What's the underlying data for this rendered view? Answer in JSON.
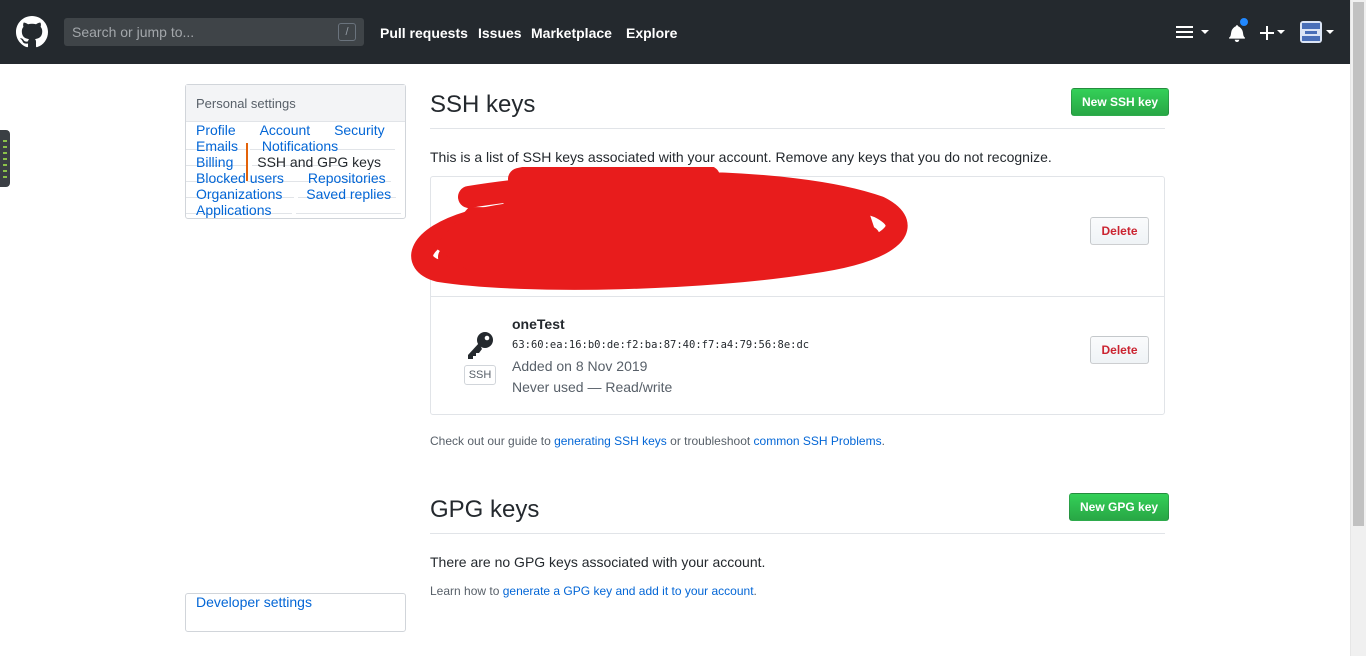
{
  "header": {
    "search_placeholder": "Search or jump to...",
    "search_shortcut": "/",
    "nav": [
      "Pull requests",
      "Issues",
      "Marketplace",
      "Explore"
    ],
    "icons": [
      "github-logo-icon",
      "hamburger-menu-icon",
      "bell-icon",
      "plus-icon",
      "avatar-icon"
    ]
  },
  "sidebar": {
    "heading": "Personal settings",
    "items": [
      {
        "label": "Profile"
      },
      {
        "label": "Account"
      },
      {
        "label": "Security"
      },
      {
        "label": "Emails"
      },
      {
        "label": "Notifications"
      },
      {
        "label": "Billing"
      },
      {
        "label": "SSH and GPG keys",
        "selected": true
      },
      {
        "label": "Blocked users"
      },
      {
        "label": "Repositories"
      },
      {
        "label": "Organizations"
      },
      {
        "label": "Saved replies"
      },
      {
        "label": "Applications"
      }
    ],
    "developer": "Developer settings"
  },
  "ssh": {
    "title": "SSH keys",
    "new_button": "New SSH key",
    "intro": "This is a list of SSH keys associated with your account. Remove any keys that you do not recognize.",
    "keys": [
      {
        "redacted": true,
        "delete": "Delete"
      },
      {
        "title": "oneTest",
        "fingerprint": "63:60:ea:16:b0:de:f2:ba:87:40:f7:a4:79:56:8e:dc",
        "added": "Added on 8 Nov 2019",
        "usage": "Never used — Read/write",
        "type_label": "SSH",
        "delete": "Delete"
      }
    ],
    "guide": {
      "pre": "Check out our guide to ",
      "link1": "generating SSH keys",
      "mid": " or troubleshoot ",
      "link2": "common SSH Problems",
      "post": "."
    }
  },
  "gpg": {
    "title": "GPG keys",
    "new_button": "New GPG key",
    "empty": "There are no GPG keys associated with your account.",
    "learn": {
      "pre": "Learn how to ",
      "link": "generate a GPG key and add it to your account",
      "post": "."
    }
  },
  "colors": {
    "header_bg": "#24292e",
    "link": "#0366d6",
    "green": "#28a745",
    "danger": "#cb2431",
    "selected_border": "#e36209",
    "redaction": "#e81c1c",
    "notification": "#2188ff"
  }
}
